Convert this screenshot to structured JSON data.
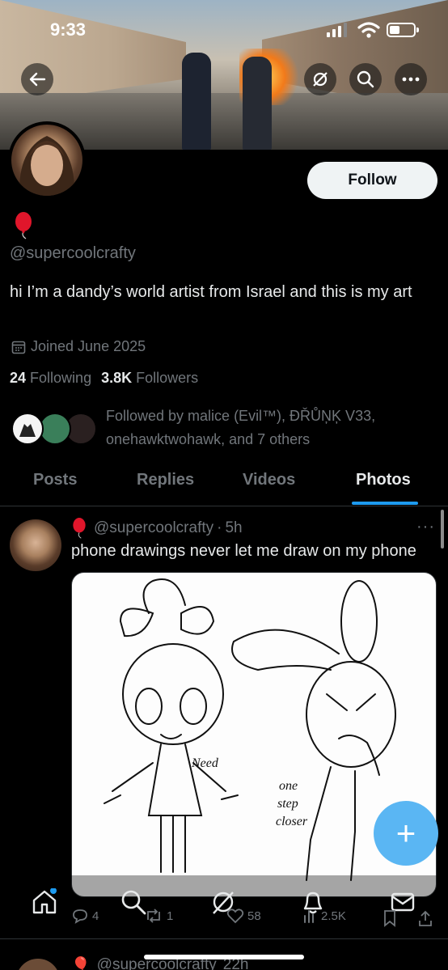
{
  "status_bar": {
    "time": "9:33"
  },
  "profile": {
    "emoji_badge": "🎈",
    "handle": "@supercoolcrafty",
    "bio": "hi I’m a dandy’s world artist from Israel and this is my art",
    "joined": "Joined June 2025",
    "following_count": "24",
    "following_label": "Following",
    "followers_count": "3.8K",
    "followers_label": "Followers",
    "followed_by": "Followed by malice (Evil™), ĐŘŮŅĶ V33, onehawktwohawk, and 7 others",
    "follow_label": "Follow"
  },
  "tabs": [
    {
      "label": "Posts"
    },
    {
      "label": "Replies"
    },
    {
      "label": "Videos"
    },
    {
      "label": "Photos",
      "active": true
    }
  ],
  "post": {
    "emoji": "🎈",
    "handle": "@supercoolcrafty",
    "dot": "·",
    "time": "5h",
    "more": "···",
    "text": "phone drawings never let me draw on my phone",
    "drawing_labels": {
      "need": "Need",
      "one": "one",
      "step": "step",
      "closer": "closer"
    },
    "replies": "4",
    "reposts": "1",
    "likes": "58",
    "views": "2.5K"
  },
  "next_post": {
    "emoji": "🎈",
    "handle": "@supercoolcrafty",
    "time": "22h"
  },
  "colors": {
    "accent": "#1d9bf0",
    "fab": "#5ab6f3",
    "muted": "#71767b"
  },
  "icons": [
    "back-arrow-icon",
    "mute-icon",
    "search-icon",
    "more-icon",
    "calendar-icon",
    "home-icon",
    "search-nav-icon",
    "grok-icon",
    "notifications-icon",
    "messages-icon",
    "reply-icon",
    "repost-icon",
    "like-icon",
    "views-icon",
    "bookmark-icon",
    "share-icon",
    "compose-plus-icon"
  ]
}
